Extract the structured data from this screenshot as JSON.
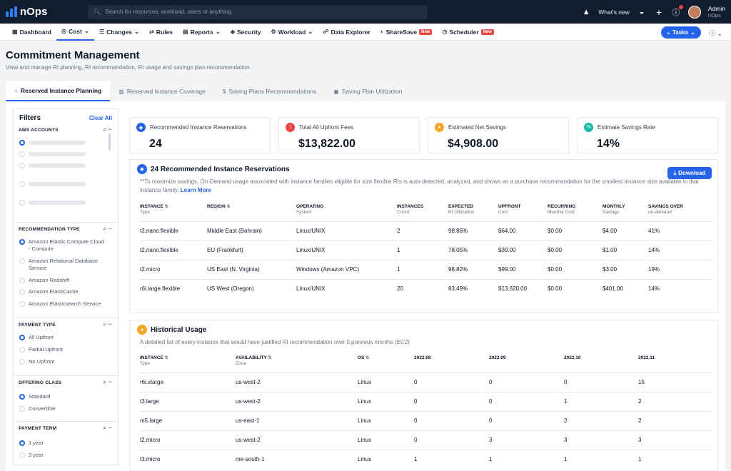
{
  "app": {
    "name": "nOps"
  },
  "search": {
    "placeholder": "Search for resources, workload, users or anything."
  },
  "topbar": {
    "whats_new": "What's new",
    "user_name": "Admin",
    "user_org": "nOps"
  },
  "nav": {
    "items": [
      {
        "label": "Dashboard",
        "icon": "dashboard-icon"
      },
      {
        "label": "Cost",
        "icon": "cost-icon",
        "active": true
      },
      {
        "label": "Changes",
        "icon": "changes-icon"
      },
      {
        "label": "Rules",
        "icon": "rules-icon"
      },
      {
        "label": "Reports",
        "icon": "reports-icon"
      },
      {
        "label": "Security",
        "icon": "security-icon"
      },
      {
        "label": "Workload",
        "icon": "workload-icon"
      },
      {
        "label": "Data Explorer",
        "icon": "data-explorer-icon"
      },
      {
        "label": "ShareSave",
        "icon": "sharesave-icon",
        "badge": "New"
      },
      {
        "label": "Scheduler",
        "icon": "scheduler-icon",
        "badge": "New"
      }
    ],
    "tasks": "Tasks"
  },
  "page": {
    "title": "Commitment Management",
    "subtitle": "View and manage RI planning, RI recommendation, RI usage and savings plan recommendation."
  },
  "tabs": [
    {
      "label": "Reserved Instance Planning",
      "active": true
    },
    {
      "label": "Reserved Instance Coverage"
    },
    {
      "label": "Saving Plans Recommendations"
    },
    {
      "label": "Saving Plan Utilization"
    }
  ],
  "filters": {
    "title": "Filters",
    "clear": "Clear All",
    "aws_accounts": {
      "title": "AWS ACCOUNTS"
    },
    "rec_type": {
      "title": "RECOMMENDATION TYPE",
      "options": [
        "Amazon Elastic Compute Cloud - Compute",
        "Amazon Relational Database Service",
        "Amazon Redshift",
        "Amazon ElastiCache",
        "Amazon Elasticsearch Service"
      ]
    },
    "payment_type": {
      "title": "PAYMENT TYPE",
      "options": [
        "All Upfront",
        "Partial Upfront",
        "No Upfront"
      ]
    },
    "offering_class": {
      "title": "OFFERING CLASS",
      "options": [
        "Standard",
        "Convertible"
      ]
    },
    "payment_term": {
      "title": "PAYMENT TERM",
      "options": [
        "1 year",
        "3 year"
      ]
    }
  },
  "cards": [
    {
      "label": "Recommended Instance Reservations",
      "value": "24",
      "color": "#2563eb"
    },
    {
      "label": "Total All Upfront Fees",
      "value": "$13,822.00",
      "color": "#ef4444"
    },
    {
      "label": "Estimated Net Savings",
      "value": "$4,908.00",
      "color": "#f5a623"
    },
    {
      "label": "Estimate Savings Rate",
      "value": "14%",
      "color": "#14b8a6"
    }
  ],
  "recommendations": {
    "title": "24 Recommended Instance Reservations",
    "note": "**To maximize savings, On-Demand usage associated with instance families eligible for size flexible RIs is auto-detected, analyzed, and shown as a purchase recommendation for the smallest instance size available in that instance family.",
    "learn_more": "Learn More",
    "download": "Download",
    "columns": [
      {
        "h": "INSTANCE",
        "s": "Type"
      },
      {
        "h": "REGION",
        "s": ""
      },
      {
        "h": "OPERATING",
        "s": "System"
      },
      {
        "h": "INSTANCES",
        "s": "Count"
      },
      {
        "h": "EXPECTED",
        "s": "RI Utilization"
      },
      {
        "h": "UPFRONT",
        "s": "Cost"
      },
      {
        "h": "RECURRING",
        "s": "Monthly Cost"
      },
      {
        "h": "MONTHLY",
        "s": "Savings"
      },
      {
        "h": "SAVINGS OVER",
        "s": "on-demand"
      }
    ],
    "rows": [
      [
        "t3.nano.flexible",
        "Middle East (Bahrain)",
        "Linux/UNIX",
        "2",
        "98.86%",
        "$64.00",
        "$0.00",
        "$4.00",
        "41%"
      ],
      [
        "t2.nano.flexible",
        "EU (Frankfurt)",
        "Linux/UNIX",
        "1",
        "78.05%",
        "$39.00",
        "$0.00",
        "$1.00",
        "14%"
      ],
      [
        "t2.micro",
        "US East (N. Virginia)",
        "Windows (Amazon VPC)",
        "1",
        "98.82%",
        "$99.00",
        "$0.00",
        "$3.00",
        "19%"
      ],
      [
        "r6i.large.flexible",
        "US West (Oregon)",
        "Linux/UNIX",
        "20",
        "83.49%",
        "$13,620.00",
        "$0.00",
        "$401.00",
        "14%"
      ]
    ]
  },
  "historical": {
    "title": "Historical Usage",
    "note": "A detailed list of every instance that would have justified RI recommendation over 5 previous months (EC2)",
    "columns": [
      {
        "h": "INSTANCE",
        "s": "Type"
      },
      {
        "h": "AVAILABILITY",
        "s": "Zone"
      },
      {
        "h": "OS",
        "s": ""
      },
      {
        "h": "2022.08",
        "s": ""
      },
      {
        "h": "2022.09",
        "s": ""
      },
      {
        "h": "2022.10",
        "s": ""
      },
      {
        "h": "2022.11",
        "s": ""
      }
    ],
    "rows": [
      [
        "r6i.xlarge",
        "us-west-2",
        "Linux",
        "0",
        "0",
        "0",
        "15"
      ],
      [
        "t3.large",
        "us-west-2",
        "Linux",
        "0",
        "0",
        "1",
        "2"
      ],
      [
        "m5.large",
        "us-east-1",
        "Linux",
        "0",
        "0",
        "2",
        "2"
      ],
      [
        "t2.micro",
        "us-west-2",
        "Linux",
        "0",
        "3",
        "3",
        "3"
      ],
      [
        "t3.micro",
        "me-south-1",
        "Linux",
        "1",
        "1",
        "1",
        "1"
      ]
    ]
  }
}
